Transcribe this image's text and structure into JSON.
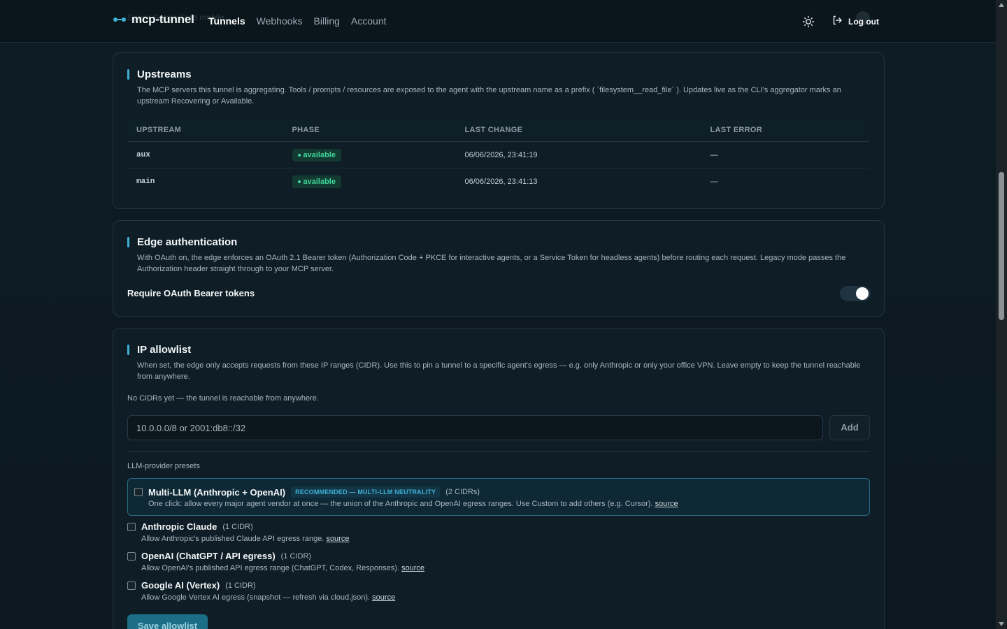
{
  "header": {
    "brand": "mcp-tunnel",
    "ghost_text": "Sanes Sanes Surd mobile...",
    "nav": [
      "Tunnels",
      "Webhooks",
      "Billing",
      "Account"
    ],
    "logout": "Log out"
  },
  "upstreams": {
    "title": "Upstreams",
    "description": "The MCP servers this tunnel is aggregating. Tools / prompts / resources are exposed to the agent with the upstream name as a prefix ( `filesystem__read_file` ). Updates live as the CLI's aggregator marks an upstream Recovering or Available.",
    "columns": [
      "UPSTREAM",
      "PHASE",
      "LAST CHANGE",
      "LAST ERROR"
    ],
    "rows": [
      {
        "name": "aux",
        "phase": "available",
        "last_change": "06/06/2026, 23:41:19",
        "last_error": "—"
      },
      {
        "name": "main",
        "phase": "available",
        "last_change": "06/06/2026, 23:41:13",
        "last_error": "—"
      }
    ]
  },
  "edge_auth": {
    "title": "Edge authentication",
    "description": "With OAuth on, the edge enforces an OAuth 2.1 Bearer token (Authorization Code + PKCE for interactive agents, or a Service Token for headless agents) before routing each request. Legacy mode passes the Authorization header straight through to your MCP server.",
    "toggle_label": "Require OAuth Bearer tokens",
    "toggle_on": true
  },
  "ip_allowlist": {
    "title": "IP allowlist",
    "description": "When set, the edge only accepts requests from these IP ranges (CIDR). Use this to pin a tunnel to a specific agent's egress — e.g. only Anthropic or only your office VPN. Leave empty to keep the tunnel reachable from anywhere.",
    "empty_note": "No CIDRs yet — the tunnel is reachable from anywhere.",
    "input_placeholder": "10.0.0.0/8 or 2001:db8::/32",
    "add_label": "Add",
    "presets_label": "LLM-provider presets",
    "presets": [
      {
        "title": "Multi-LLM (Anthropic + OpenAI)",
        "badge": "RECOMMENDED — MULTI-LLM NEUTRALITY",
        "count": "(2 CIDRs)",
        "desc": "One click: allow every major agent vendor at once — the union of the Anthropic and OpenAI egress ranges. Use Custom to add others (e.g. Cursor).",
        "link": "source"
      },
      {
        "title": "Anthropic Claude",
        "count": "(1 CIDR)",
        "desc": "Allow Anthropic's published Claude API egress range.",
        "link": "source"
      },
      {
        "title": "OpenAI (ChatGPT / API egress)",
        "count": "(1 CIDR)",
        "desc": "Allow OpenAI's published API egress range (ChatGPT, Codex, Responses).",
        "link": "source"
      },
      {
        "title": "Google AI (Vertex)",
        "count": "(1 CIDR)",
        "desc": "Allow Google Vertex AI egress (snapshot — refresh via cloud.json).",
        "link": "source"
      }
    ],
    "save_label": "Save allowlist"
  },
  "colors": {
    "accent": "#3fb0d6",
    "success": "#3fd59a",
    "background": "#0d1b22"
  }
}
